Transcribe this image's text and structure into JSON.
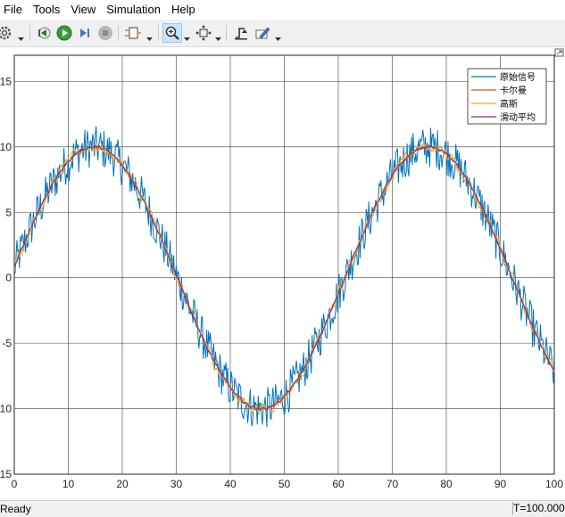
{
  "menu": {
    "file": "File",
    "tools": "Tools",
    "view": "View",
    "simulation": "Simulation",
    "help": "Help"
  },
  "toolbar": {
    "icons": [
      "settings-icon",
      "step-back-icon",
      "run-icon",
      "step-forward-icon",
      "stop-icon",
      "signal-select-icon",
      "zoom-icon",
      "fit-to-view-icon",
      "trigger-icon",
      "style-icon"
    ]
  },
  "status": {
    "text": "Ready",
    "time": "T=100.000"
  },
  "chart_data": {
    "type": "line",
    "title": "",
    "xlabel": "",
    "ylabel": "",
    "xlim": [
      0,
      100
    ],
    "ylim": [
      -15,
      17
    ],
    "xticks": [
      0,
      10,
      20,
      30,
      40,
      50,
      60,
      70,
      80,
      90,
      100
    ],
    "yticks": [
      15,
      10,
      5,
      0,
      -5,
      -10,
      -15
    ],
    "ytick_labels": [
      "15",
      "10",
      "5",
      "0",
      "-5",
      "10",
      "15"
    ],
    "grid": true,
    "legend_position": "top-right",
    "underlying_signal": "y = 10 * sin(2*pi*x/62)",
    "series": [
      {
        "name": "原始信号",
        "color": "#0072bd",
        "noise_amplitude": 1.6,
        "samples": 620
      },
      {
        "name": "卡尔曼",
        "color": "#d95319",
        "noise_amplitude": 0.15,
        "samples": 620
      },
      {
        "name": "高斯",
        "color": "#edb120",
        "noise_amplitude": 0.7,
        "samples": 620
      },
      {
        "name": "滑动平均",
        "color": "#7e2f8e",
        "noise_amplitude": 0.2,
        "samples": 620
      }
    ]
  }
}
